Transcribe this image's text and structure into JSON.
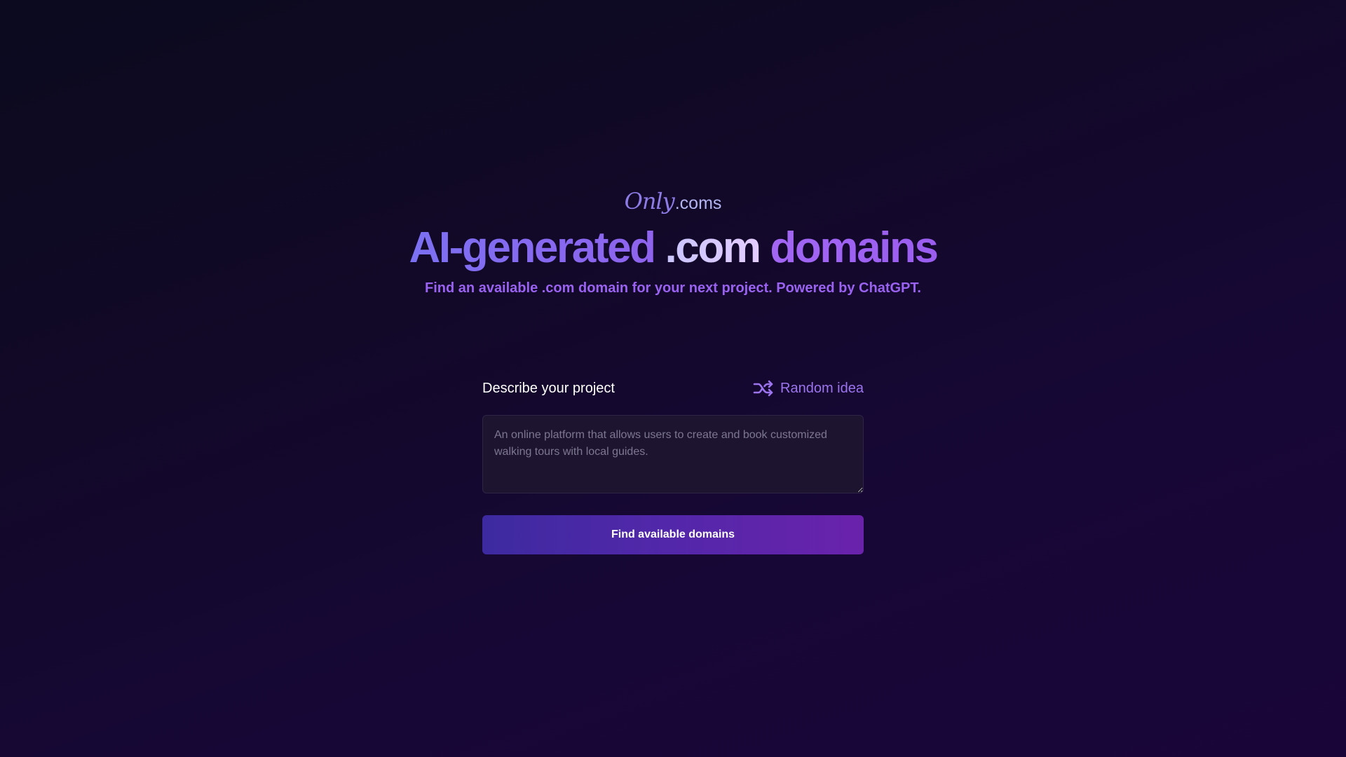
{
  "logo": {
    "script_part": "Only",
    "suffix": ".coms"
  },
  "headline": {
    "part1": "AI-generated",
    "part2": ".com",
    "part3": "domains"
  },
  "subtitle": "Find an available .com domain for your next project. Powered by ChatGPT.",
  "form": {
    "label": "Describe your project",
    "random_label": "Random idea",
    "random_icon": "shuffle-icon",
    "textarea_value": "",
    "textarea_placeholder": "An online platform that allows users to create and book customized walking tours with local guides.",
    "submit_label": "Find available domains"
  },
  "colors": {
    "accent": "#9b74ee",
    "button_start": "#3d2aa0",
    "button_end": "#6a22ab",
    "background": "#120928"
  }
}
